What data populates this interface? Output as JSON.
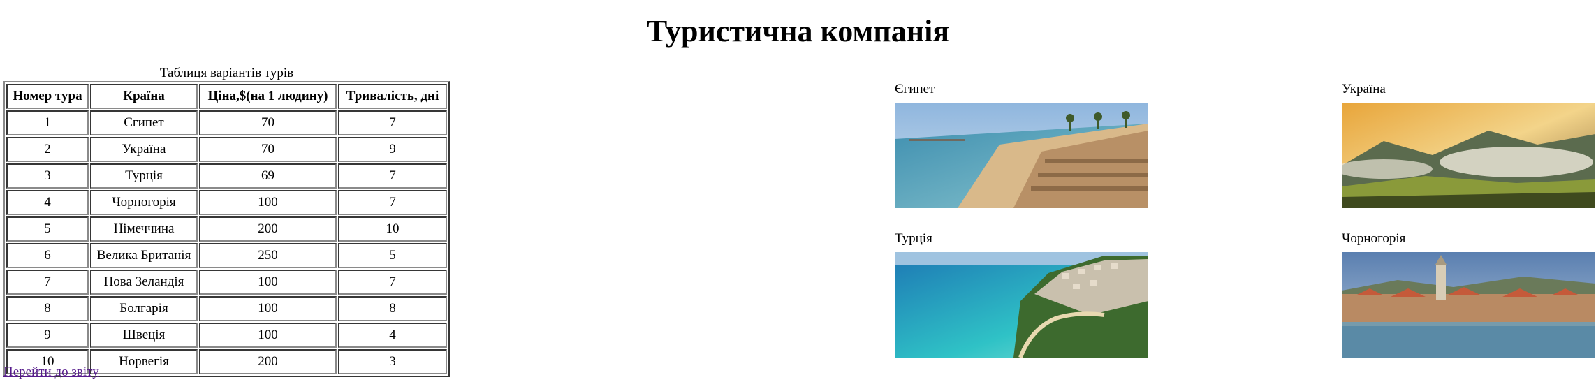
{
  "page": {
    "title": "Туристична компанія"
  },
  "table": {
    "caption": "Таблиця варіантів турів",
    "headers": [
      "Номер тура",
      "Країна",
      "Ціна,$(на 1 людину)",
      "Тривалість, дні"
    ],
    "rows": [
      [
        "1",
        "Єгипет",
        "70",
        "7"
      ],
      [
        "2",
        "Україна",
        "70",
        "9"
      ],
      [
        "3",
        "Турція",
        "69",
        "7"
      ],
      [
        "4",
        "Чорногорія",
        "100",
        "7"
      ],
      [
        "5",
        "Німеччина",
        "200",
        "10"
      ],
      [
        "6",
        "Велика Британія",
        "250",
        "5"
      ],
      [
        "7",
        "Нова Зеландія",
        "100",
        "7"
      ],
      [
        "8",
        "Болгарія",
        "100",
        "8"
      ],
      [
        "9",
        "Швеція",
        "100",
        "4"
      ],
      [
        "10",
        "Норвегія",
        "200",
        "3"
      ]
    ]
  },
  "report_link": {
    "label": "Перейти до звіту"
  },
  "gallery": [
    {
      "label": "Єгипет",
      "photo": "egypt-beach-photo"
    },
    {
      "label": "Україна",
      "photo": "ukraine-mountains-photo"
    },
    {
      "label": "Турція",
      "photo": "turkey-coast-photo"
    },
    {
      "label": "Чорногорія",
      "photo": "montenegro-town-photo"
    }
  ],
  "colors": {
    "link": "#551a8b",
    "border": "#8a8a8a"
  }
}
